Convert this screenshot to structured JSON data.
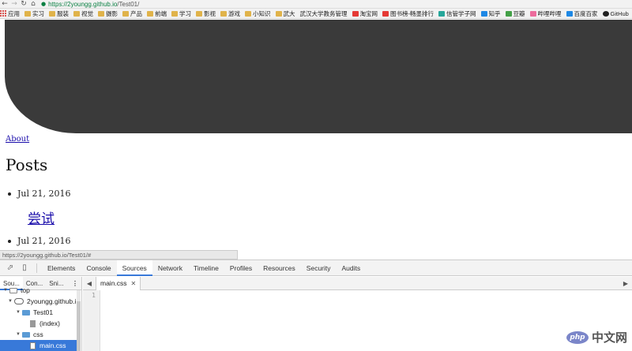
{
  "browser": {
    "url_scheme": "https://",
    "url_host": "2youngg.github.io",
    "url_path": "/Test01/"
  },
  "bookmarks": [
    {
      "label": "应用",
      "icon": "apps-icon"
    },
    {
      "label": "实习",
      "icon": "folder-icon"
    },
    {
      "label": "服装",
      "icon": "folder-icon"
    },
    {
      "label": "视觉",
      "icon": "folder-icon"
    },
    {
      "label": "摄影",
      "icon": "folder-icon"
    },
    {
      "label": "产品",
      "icon": "folder-icon"
    },
    {
      "label": "前端",
      "icon": "folder-icon"
    },
    {
      "label": "学习",
      "icon": "folder-icon"
    },
    {
      "label": "影视",
      "icon": "folder-icon"
    },
    {
      "label": "游戏",
      "icon": "folder-icon"
    },
    {
      "label": "小知识",
      "icon": "folder-icon"
    },
    {
      "label": "武大",
      "icon": "folder-icon"
    },
    {
      "label": "武汉大学教务管理",
      "icon": "page-icon"
    },
    {
      "label": "淘宝网",
      "icon": "taobao-icon"
    },
    {
      "label": "图书榜-畅墨排行",
      "icon": "books-icon"
    },
    {
      "label": "信管学子网",
      "icon": "site-icon"
    },
    {
      "label": "知乎",
      "icon": "zhihu-icon"
    },
    {
      "label": "豆瓣",
      "icon": "douban-icon"
    },
    {
      "label": "哔哩哔哩",
      "icon": "bilibili-icon"
    },
    {
      "label": "百度百家",
      "icon": "baidu-icon"
    },
    {
      "label": "GitHub",
      "icon": "github-icon"
    }
  ],
  "page": {
    "nav_link": "About",
    "heading": "Posts",
    "posts": [
      {
        "date": "Jul 21, 2016",
        "title": "尝试"
      },
      {
        "date": "Jul 21, 2016"
      }
    ],
    "status_url": "https://2youngg.github.io/Test01/#"
  },
  "devtools": {
    "tabs": [
      "Elements",
      "Console",
      "Sources",
      "Network",
      "Timeline",
      "Profiles",
      "Resources",
      "Security",
      "Audits"
    ],
    "active_tab": "Sources",
    "nav_tabs": [
      "Sou...",
      "Con...",
      "Sni..."
    ],
    "tree": {
      "top": "top",
      "host": "2youngg.github.i",
      "folder": "Test01",
      "index": "(index)",
      "css_folder": "css",
      "file": "main.css"
    },
    "editor_tab": "main.css",
    "line_number": "1"
  },
  "watermark": {
    "logo": "php",
    "text": "中文网"
  },
  "colors": {
    "hero": "#3a3a3a",
    "link": "#1a0dab",
    "accent": "#3879d9"
  }
}
